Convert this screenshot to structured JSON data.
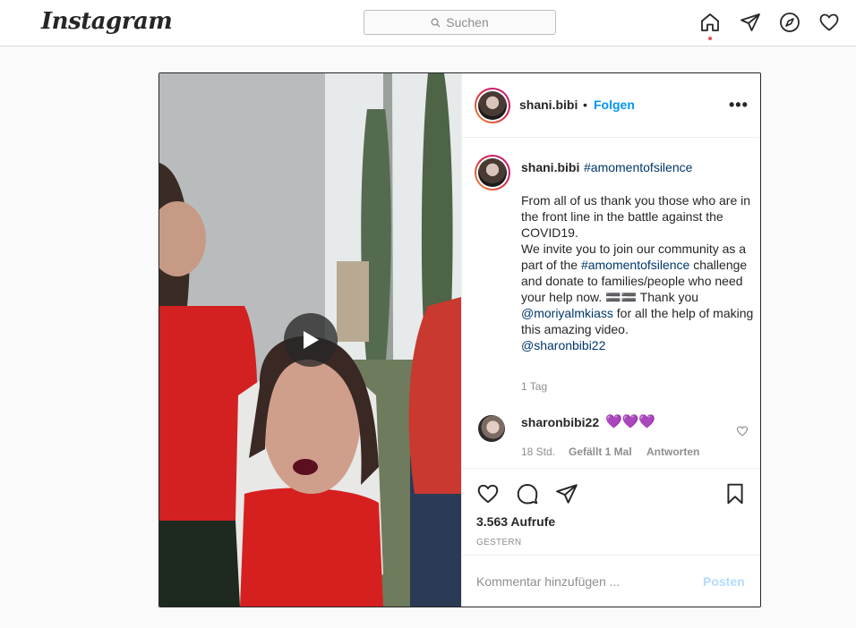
{
  "app": {
    "logo": "Instagram"
  },
  "search": {
    "placeholder": "Suchen"
  },
  "nav": {
    "icons": [
      "home-icon",
      "direct-icon",
      "explore-icon",
      "activity-icon"
    ],
    "active_dot_color": "#ed4956"
  },
  "post": {
    "username": "shani.bibi",
    "separator": "•",
    "follow_label": "Folgen",
    "more_label": "•••",
    "caption": {
      "username": "shani.bibi",
      "hashtag": "#amomentofsilence",
      "body_part1": "From all of us thank you those who are in the front line in the battle against the COVID19.\nWe invite you to join our community as a part of the ",
      "body_hashtag": "#amomentofsilence",
      "body_part2": " challenge and donate to families/people who need your help now. 🟰🟰 Thank you ",
      "body_mention1": "@moriyalmkiass",
      "body_part3": " for all the help of making this amazing video.\n",
      "body_mention2": "@sharonbibi22",
      "time": "1 Tag"
    },
    "comment": {
      "username": "sharonbibi22",
      "text": "💜💜💜",
      "time": "18 Std.",
      "likes": "Gefällt 1 Mal",
      "reply_label": "Antworten"
    },
    "views": "3.563 Aufrufe",
    "date": "GESTERN",
    "comment_placeholder": "Kommentar hinzufügen ...",
    "post_label": "Posten"
  },
  "colors": {
    "link": "#00376b",
    "follow": "#0095f6",
    "post_disabled": "#b3dbff"
  }
}
